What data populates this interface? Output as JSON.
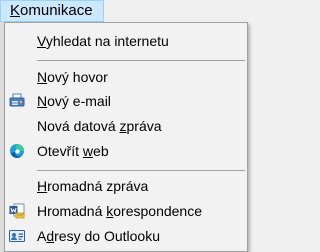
{
  "menubar": {
    "label_accel": "K",
    "label_rest": "omunikace"
  },
  "menu": {
    "items": [
      {
        "pre": "",
        "accel": "V",
        "post": "yhledat na internetu",
        "icon": ""
      },
      {
        "pre": "",
        "accel": "N",
        "post": "ový hovor",
        "icon": ""
      },
      {
        "pre": "",
        "accel": "N",
        "post": "ový e-mail",
        "icon": "fax-printer-icon"
      },
      {
        "pre": "Nová datová ",
        "accel": "z",
        "post": "práva",
        "icon": ""
      },
      {
        "pre": "Otevřít ",
        "accel": "w",
        "post": "eb",
        "icon": "edge-browser-icon"
      },
      {
        "pre": "",
        "accel": "H",
        "post": "romadná zpráva",
        "icon": ""
      },
      {
        "pre": "Hromadná ",
        "accel": "k",
        "post": "orespondence",
        "icon": "word-mailmerge-icon"
      },
      {
        "pre": "A",
        "accel": "d",
        "post": "resy do Outlooku",
        "icon": "contact-card-icon"
      }
    ]
  },
  "colors": {
    "menubar_highlight": "#cce8ff",
    "menubar_border": "#99d1ff",
    "menu_bg": "#f2f2f2",
    "separator": "#a0a0a0"
  }
}
